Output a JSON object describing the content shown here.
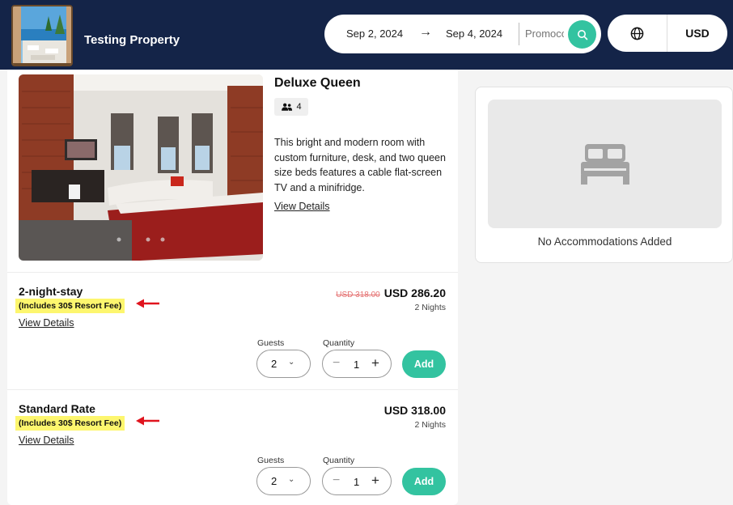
{
  "header": {
    "property_name": "Testing Property",
    "check_in": "Sep 2, 2024",
    "check_out": "Sep 4, 2024",
    "promo_placeholder": "Promocode",
    "currency": "USD"
  },
  "room": {
    "title": "Deluxe Queen",
    "occupancy": "4",
    "description": "This bright and modern room with custom furniture, desk, and two queen size beds features a cable flat-screen TV and a minifridge.",
    "view_details": "View Details"
  },
  "rates": [
    {
      "name": "2-night-stay",
      "fee_note": "(Includes 30$ Resort Fee)",
      "view_details": "View Details",
      "old_price": "USD 318.00",
      "price": "USD 286.20",
      "nights": "2 Nights",
      "guests_label": "Guests",
      "guests_value": "2",
      "quantity_label": "Quantity",
      "quantity_value": "1",
      "add_label": "Add"
    },
    {
      "name": "Standard Rate",
      "fee_note": "(Includes 30$ Resort Fee)",
      "view_details": "View Details",
      "old_price": "",
      "price": "USD 318.00",
      "nights": "2 Nights",
      "guests_label": "Guests",
      "guests_value": "2",
      "quantity_label": "Quantity",
      "quantity_value": "1",
      "add_label": "Add"
    }
  ],
  "cart": {
    "empty_text": "No Accommodations Added"
  },
  "colors": {
    "header_bg": "#142448",
    "accent": "#33c3a0",
    "highlight": "#fdf66e",
    "annotation_arrow": "#e0141e",
    "strike_price": "#e57373"
  },
  "icons": [
    "search-icon",
    "arrow-right-icon",
    "globe-icon",
    "users-icon",
    "bed-icon",
    "chevron-down-icon",
    "minus-icon",
    "plus-icon"
  ]
}
